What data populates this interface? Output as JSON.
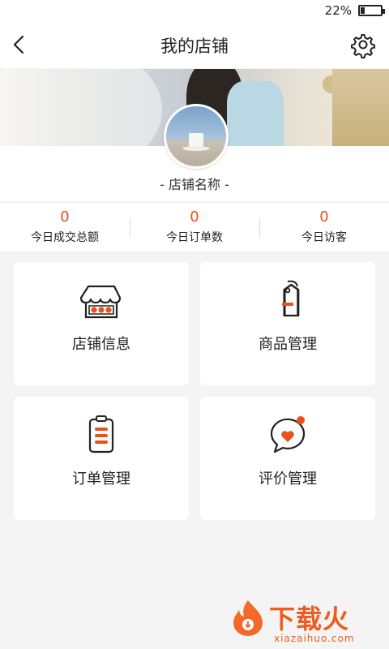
{
  "status_bar": {
    "battery_percent": "22%",
    "battery_level": 0.22
  },
  "header": {
    "title": "我的店铺",
    "back_icon": "back-arrow-icon",
    "settings_icon": "gear-icon"
  },
  "shop": {
    "name": "- 店铺名称 -"
  },
  "stats": [
    {
      "value": "0",
      "label": "今日成交总额"
    },
    {
      "value": "0",
      "label": "今日订单数"
    },
    {
      "value": "0",
      "label": "今日访客"
    }
  ],
  "menu": [
    {
      "label": "店铺信息",
      "icon": "store-icon"
    },
    {
      "label": "商品管理",
      "icon": "price-tag-icon"
    },
    {
      "label": "订单管理",
      "icon": "clipboard-icon"
    },
    {
      "label": "评价管理",
      "icon": "comment-heart-icon"
    }
  ],
  "colors": {
    "accent": "#e8521b",
    "background": "#f4f4f4",
    "text": "#222222"
  },
  "watermark": {
    "text": "下载火",
    "url": "xiazaihuo.com"
  }
}
